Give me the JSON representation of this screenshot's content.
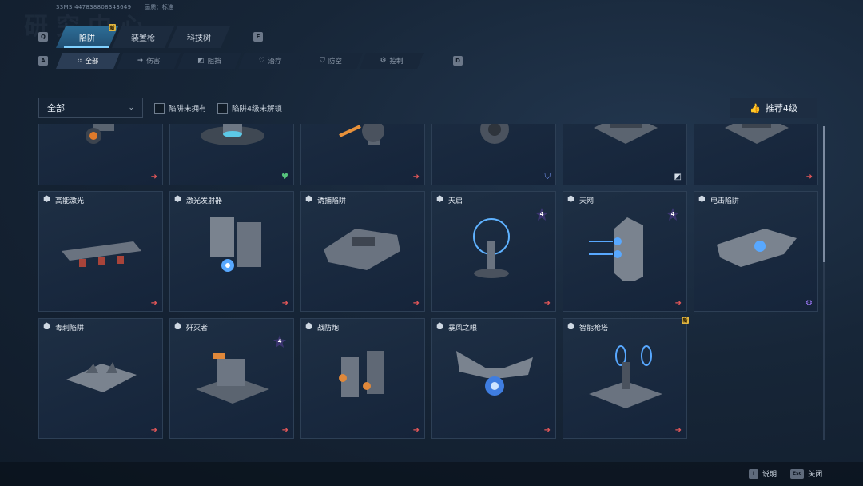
{
  "header": {
    "user_id": "33MS  4478388083436​49",
    "quality_label": "画质：标准",
    "bg_title": "研究中心"
  },
  "main_tabs": {
    "left_key": "Q",
    "right_key": "E",
    "items": [
      {
        "label": "陷阱",
        "active": true,
        "new": true
      },
      {
        "label": "装置枪",
        "active": false,
        "new": false
      },
      {
        "label": "科技树",
        "active": false,
        "new": false
      }
    ],
    "new_badge": "新"
  },
  "sub_tabs": {
    "left_key": "A",
    "right_key": "D",
    "items": [
      {
        "label": "全部",
        "icon": "grid-icon",
        "active": true
      },
      {
        "label": "伤害",
        "icon": "arrow-right-icon",
        "active": false
      },
      {
        "label": "阻挡",
        "icon": "block-icon",
        "active": false
      },
      {
        "label": "治疗",
        "icon": "heart-icon",
        "active": false
      },
      {
        "label": "防空",
        "icon": "shield-icon",
        "active": false
      },
      {
        "label": "控制",
        "icon": "gear-icon",
        "active": false
      }
    ]
  },
  "filters": {
    "dropdown_value": "全部",
    "check_not_owned": "陷阱未拥有",
    "check_lvl4_locked": "陷阱4级未解锁",
    "recommend_label": "推荐4级"
  },
  "cards_row1": [
    {
      "name": "",
      "tag": "damage"
    },
    {
      "name": "",
      "tag": "heal"
    },
    {
      "name": "",
      "tag": "damage"
    },
    {
      "name": "",
      "tag": "air-defense"
    },
    {
      "name": "",
      "tag": "block"
    },
    {
      "name": "",
      "tag": "damage"
    }
  ],
  "cards_row2": [
    {
      "name": "高能激光",
      "tag": "damage",
      "lvl4": false
    },
    {
      "name": "激光发射器",
      "tag": "damage",
      "lvl4": false
    },
    {
      "name": "诱捕陷阱",
      "tag": "damage",
      "lvl4": false
    },
    {
      "name": "天启",
      "tag": "damage",
      "lvl4": true
    },
    {
      "name": "天网",
      "tag": "damage",
      "lvl4": true
    },
    {
      "name": "电击陷阱",
      "tag": "control",
      "lvl4": false
    }
  ],
  "cards_row3": [
    {
      "name": "毒刺陷阱",
      "tag": "damage",
      "lvl4": false
    },
    {
      "name": "歼灭者",
      "tag": "damage",
      "lvl4": true
    },
    {
      "name": "战防炮",
      "tag": "damage",
      "lvl4": false
    },
    {
      "name": "暴风之眼",
      "tag": "damage",
      "lvl4": false
    },
    {
      "name": "智能枪塔",
      "tag": "damage",
      "lvl4": false,
      "new": true
    }
  ],
  "lvl4_text": "4",
  "footer": {
    "help_key": "I",
    "help_label": "说明",
    "close_key": "Esc",
    "close_label": "关闭"
  },
  "colors": {
    "damage": "#e05658",
    "heal": "#56c47c",
    "control": "#a17bff",
    "active_tab": "#2d6d96",
    "new_badge": "#e2b640"
  }
}
